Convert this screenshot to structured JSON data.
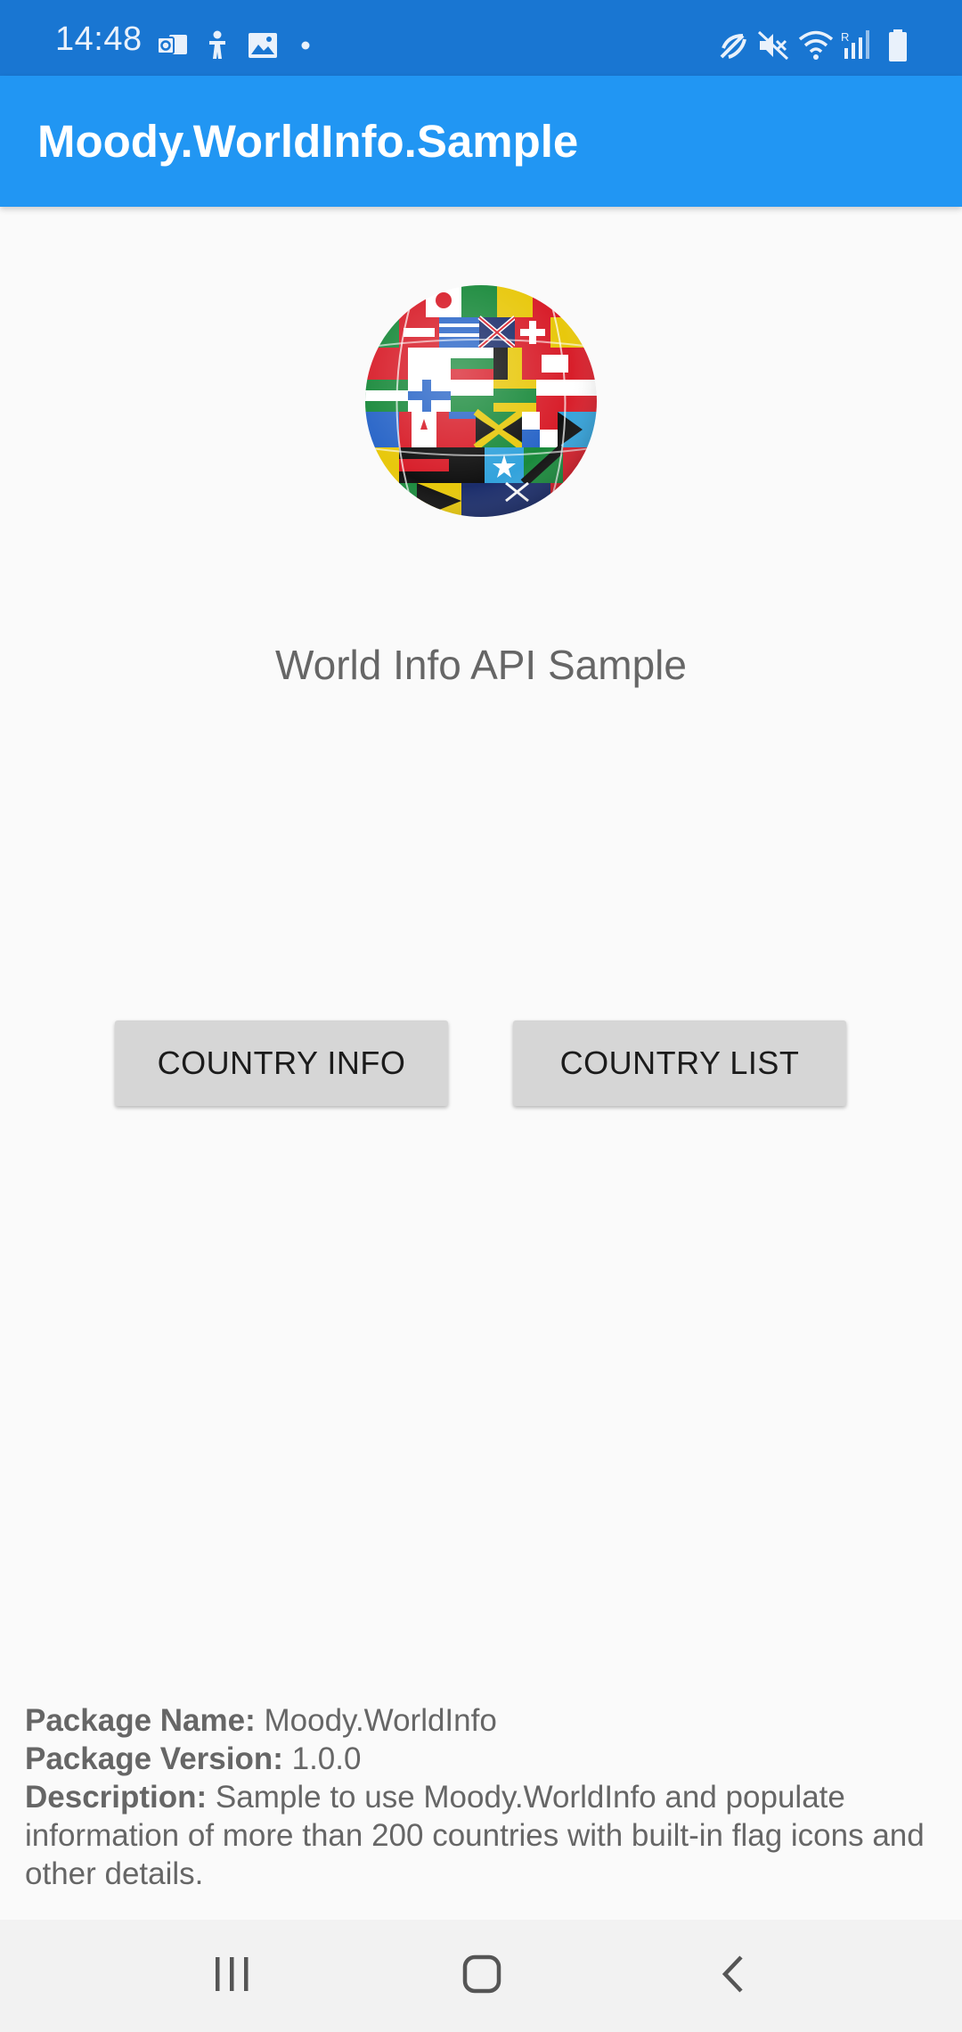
{
  "status_bar": {
    "time": "14:48",
    "left_icons": [
      "outlook-icon",
      "accessibility-icon",
      "image-icon",
      "dot-icon"
    ],
    "right_icons": [
      "nfc-icon",
      "mute-icon",
      "wifi-icon",
      "signal-icon",
      "battery-icon"
    ]
  },
  "app_bar": {
    "title": "Moody.WorldInfo.Sample"
  },
  "main": {
    "subtitle": "World Info API Sample",
    "buttons": {
      "country_info": "COUNTRY INFO",
      "country_list": "COUNTRY LIST"
    }
  },
  "package_info": {
    "name_label": "Package Name:",
    "name_value": " Moody.WorldInfo",
    "version_label": "Package Version:",
    "version_value": " 1.0.0",
    "description_label": "Description:",
    "description_value": " Sample to use Moody.WorldInfo and populate information of more than 200 countries with built-in flag icons and other details."
  },
  "nav_bar": {
    "icons": [
      "recent-apps-icon",
      "home-icon",
      "back-icon"
    ]
  },
  "colors": {
    "status_bar": "#1976d2",
    "app_bar": "#2196f3",
    "background": "#fafafa",
    "button": "#d6d6d6"
  }
}
